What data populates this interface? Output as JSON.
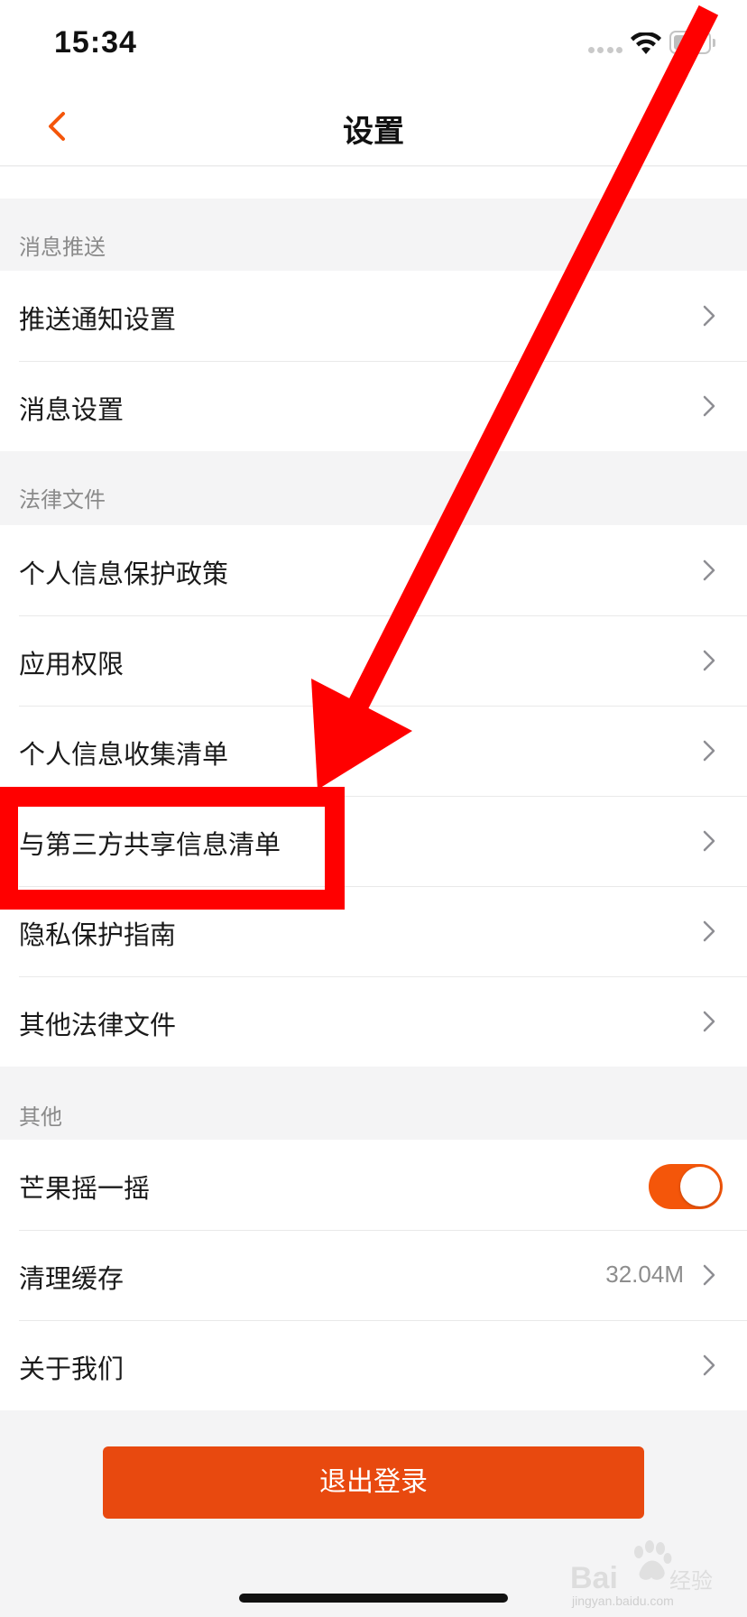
{
  "status_bar": {
    "time": "15:34"
  },
  "nav": {
    "title": "设置"
  },
  "sections": {
    "push": {
      "header": "消息推送",
      "items": [
        {
          "label": "推送通知设置"
        },
        {
          "label": "消息设置"
        }
      ]
    },
    "legal": {
      "header": "法律文件",
      "items": [
        {
          "label": "个人信息保护政策"
        },
        {
          "label": "应用权限"
        },
        {
          "label": "个人信息收集清单"
        },
        {
          "label": "与第三方共享信息清单"
        },
        {
          "label": "隐私保护指南"
        },
        {
          "label": "其他法律文件"
        }
      ]
    },
    "other": {
      "header": "其他",
      "items": [
        {
          "label": "芒果摇一摇",
          "toggle": true
        },
        {
          "label": "清理缓存",
          "value": "32.04M"
        },
        {
          "label": "关于我们"
        }
      ]
    }
  },
  "logout": {
    "label": "退出登录"
  },
  "colors": {
    "accent": "#f4560a",
    "logout": "#e8490f",
    "annotation": "#ff0000"
  },
  "watermark": {
    "text": "jingyan.baidu.com"
  }
}
